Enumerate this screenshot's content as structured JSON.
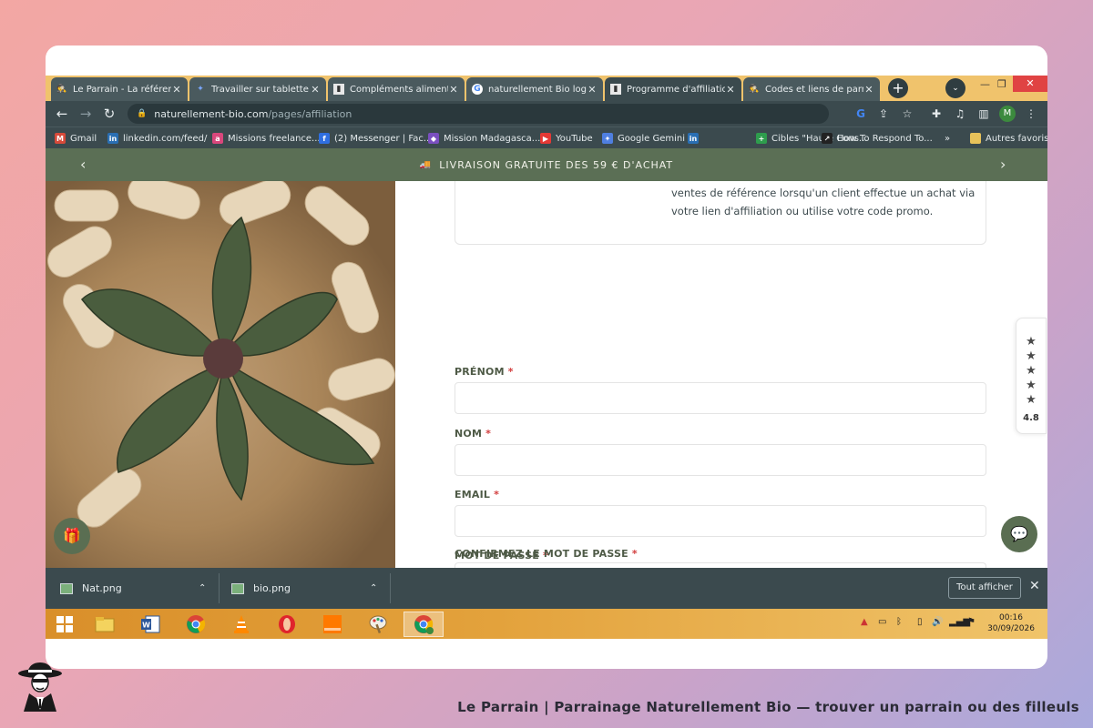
{
  "browser": {
    "tabs": [
      {
        "title": "Le Parrain - La référence",
        "active": false
      },
      {
        "title": "Travailler sur tablette par",
        "active": false
      },
      {
        "title": "Compléments alimentaires",
        "active": false
      },
      {
        "title": "naturellement Bio logo",
        "active": false
      },
      {
        "title": "Programme d'affiliation",
        "active": true
      },
      {
        "title": "Codes et liens de parrainage",
        "active": false
      }
    ],
    "url_host": "naturellement-bio.com",
    "url_path": "/pages/affiliation",
    "profile_initial": "M",
    "bookmarks": [
      {
        "label": "Gmail",
        "icon": "gmail-icon",
        "color": "#d64a3a",
        "glyph": "M"
      },
      {
        "label": "linkedin.com/feed/",
        "icon": "linkedin-icon",
        "color": "#2a6fb3",
        "glyph": "in"
      },
      {
        "label": "Missions freelance...",
        "icon": "missions-icon",
        "color": "#d9477c",
        "glyph": "a"
      },
      {
        "label": "(2) Messenger | Fac...",
        "icon": "facebook-icon",
        "color": "#2f6fe0",
        "glyph": "f"
      },
      {
        "label": "Mission Madagasca...",
        "icon": "mission-icon",
        "color": "#7a4fbf",
        "glyph": "◆"
      },
      {
        "label": "YouTube",
        "icon": "youtube-icon",
        "color": "#e53935",
        "glyph": "▶"
      },
      {
        "label": "Google Gemini",
        "icon": "gemini-icon",
        "color": "#4f7fe0",
        "glyph": "✦"
      },
      {
        "label": "",
        "icon": "linkedin-icon",
        "color": "#2a6fb3",
        "glyph": "in"
      },
      {
        "label": "Cibles \"Haute Cons...",
        "icon": "sheets-icon",
        "color": "#2e9d4d",
        "glyph": "+"
      },
      {
        "label": "How To Respond To...",
        "icon": "respond-icon",
        "color": "#222222",
        "glyph": "↗"
      },
      {
        "label": "»",
        "icon": "more-icon",
        "color": "",
        "glyph": ""
      },
      {
        "label": "Autres favoris",
        "icon": "folder-icon",
        "color": "#e8c25a",
        "glyph": ""
      }
    ]
  },
  "announcement": {
    "text": "LIVRAISON GRATUITE DES 59 € D'ACHAT"
  },
  "page": {
    "intro_text": "ventes de référence lorsqu'un client effectue un achat via votre lien d'affiliation ou utilise votre code promo.",
    "fields": [
      {
        "label": "PRÉNOM",
        "required": "*"
      },
      {
        "label": "NOM",
        "required": "*"
      },
      {
        "label": "EMAIL",
        "required": "*"
      },
      {
        "label": "MOT DE PASSE",
        "required": "*"
      },
      {
        "label": "CONFIRMEZ LE MOT DE PASSE",
        "required": "*"
      }
    ],
    "reviews": {
      "stars": "★★★★★",
      "rating": "4.8"
    }
  },
  "downloads": {
    "items": [
      {
        "name": "Nat.png"
      },
      {
        "name": "bio.png"
      }
    ],
    "show_all": "Tout afficher"
  },
  "taskbar": {
    "time": "00:16",
    "date": "30/09/2026",
    "apps": [
      "windows-start",
      "file-explorer",
      "word",
      "chrome",
      "vlc",
      "opera",
      "orange",
      "paint",
      "chrome-active"
    ]
  },
  "footer": {
    "caption": "Le Parrain | Parrainage Naturellement Bio — trouver un parrain ou des filleuls"
  },
  "colors": {
    "accent_green": "#5b6f55",
    "chrome_dark": "#3b4a4e",
    "tab_gold": "#f0c36c",
    "required_red": "#d23c3c"
  }
}
